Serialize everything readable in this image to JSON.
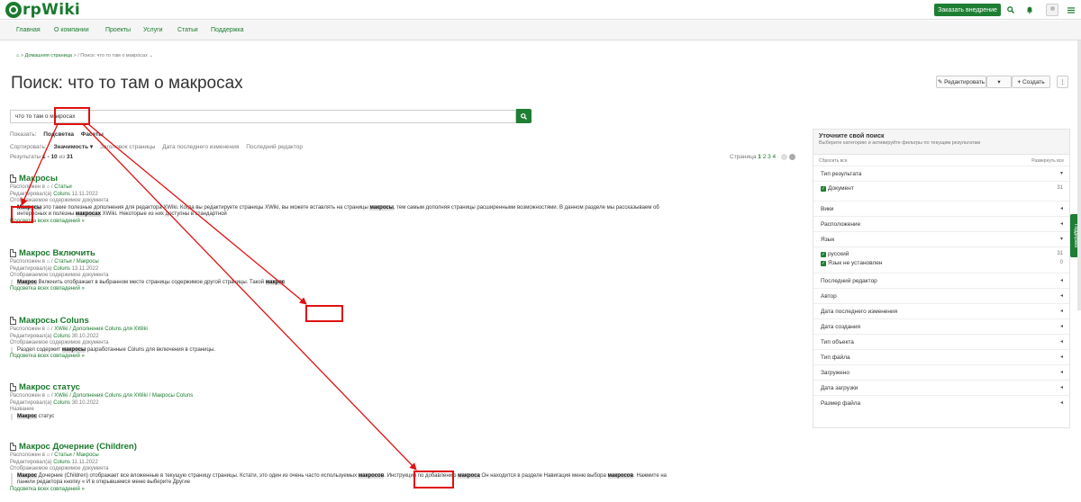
{
  "header": {
    "logo_text": "rpWiki",
    "order_button": "Заказать внедрение",
    "search_icon": "search-icon",
    "bell_icon": "bell-icon",
    "menu_icon": "hamburger-icon"
  },
  "menu": [
    "Главная",
    "О компании",
    "Проекты",
    "Услуги",
    "Статьи",
    "Поддержка"
  ],
  "breadcrumb": {
    "home": "Домашняя страница",
    "current": "Поиск: что то там о макросах"
  },
  "page_title": "Поиск: что то там о макросах",
  "actions": {
    "edit": "Редактировать",
    "create": "Создать"
  },
  "search": {
    "value": "что то там о макросах"
  },
  "show": {
    "label": "Показать:",
    "highlight": "Подсветка",
    "facets": "Фасеты"
  },
  "sort": {
    "label": "Сортировать:",
    "active": "Значимость",
    "options": [
      "Заголовок страницы",
      "Дата последнего изменения",
      "Последний редактор"
    ]
  },
  "results_summary": {
    "prefix": "Результаты",
    "range": "1 - 10",
    "of": "из",
    "total": "31"
  },
  "pagination": {
    "label": "Страница",
    "current": "1",
    "pages": "2 3 4"
  },
  "results": [
    {
      "title": "Макросы",
      "location": "Статьи",
      "edited_label": "Редактировал(а)",
      "editor": "Coluns",
      "date": "11.11.2022",
      "content_label": "Отображаемое содержимое документа",
      "more": "Подсветка всех совпадений »"
    },
    {
      "title": "Макрос Включить",
      "location": "Статьи / Макросы",
      "edited_label": "Редактировал(а)",
      "editor": "Coluns",
      "date": "13.11.2022",
      "content_label": "Отображаемое содержимое документа",
      "more": "Подсветка всех совпадений »"
    },
    {
      "title": "Макросы Coluns",
      "location": "XWiki / Дополнения Coluns для XWiki",
      "edited_label": "Редактировал(а)",
      "editor": "Coluns",
      "date": "30.10.2022",
      "content_label": "Отображаемое содержимое документа",
      "more": "Подсветка всех совпадений »"
    },
    {
      "title": "Макрос статус",
      "location": "XWiki / Дополнения Coluns для XWiki / Макросы Coluns",
      "edited_label": "Редактировал(а)",
      "editor": "Coluns",
      "date": "30.10.2022",
      "content_label": "Название"
    },
    {
      "title": "Макрос Дочерние (Children)",
      "location": "Статьи / Макросы",
      "edited_label": "Редактировал(а)",
      "editor": "Coluns",
      "date": "11.11.2022",
      "content_label": "Отображаемое содержимое документа",
      "more": "Подсветка всех совпадений »"
    }
  ],
  "excerpts": {
    "r1_a": "Макросы",
    "r1_b": " это такие полезные дополнения для редактора XWiki. Когда вы редактируете страницы XWiki, вы можете вставлять на страницы ",
    "r1_c": "макросы",
    "r1_d": ", тем самым дополняя страницы расширенными возможностями. В данном разделе мы рассказываем об",
    "r1_e": "интересных и полезны ",
    "r1_f": "макросах",
    "r1_g": " XWiki. Некоторые из них доступны в стандартной",
    "r2_a": "Макрос",
    "r2_b": " Включить отображает в выбранном месте страницы содержимое другой страницы. Такой ",
    "r2_c": "макрос",
    "r3_a": "Раздел содержит ",
    "r3_b": "макросы",
    "r3_c": " разработанные Coluns для включения в страницы.",
    "r4_a": "Макрос",
    "r4_b": " статус",
    "r5_a": "Макрос",
    "r5_b": " Дочерние (Children) отображает все вложенные в текущую страницу страницы. Кстати, это один из очень часто используемых ",
    "r5_c": "макросов",
    "r5_d": ". Инструкция по добавлению ",
    "r5_e": "макроса",
    "r5_f": " Он находится в разделе Навигация меню выбора ",
    "r5_g": "макросов",
    "r5_h": ". Нажмите на",
    "r5_i": "панели редактора кнопку « И в открывшемся меню выберите Другие",
    "located_in": "Расположен в"
  },
  "refine": {
    "title": "Уточните свой поиск",
    "subtitle": "Выберите категорию и активируйте фильтры по текущим результатам",
    "reset": "Сбросить все",
    "expand": "Развернуть все",
    "facets": [
      {
        "name": "Тип результата",
        "values": [
          {
            "label": "Документ",
            "count": "31"
          }
        ]
      },
      {
        "name": "Вики"
      },
      {
        "name": "Расположение"
      },
      {
        "name": "Язык",
        "values": [
          {
            "label": "русский",
            "count": "31"
          },
          {
            "label": "Язык не установлен",
            "count": "0"
          }
        ]
      },
      {
        "name": "Последний редактор"
      },
      {
        "name": "Автор"
      },
      {
        "name": "Дата последнего изменения"
      },
      {
        "name": "Дата создания"
      },
      {
        "name": "Тип объекта"
      },
      {
        "name": "Тип файла"
      },
      {
        "name": "Загружено"
      },
      {
        "name": "Дата загрузки"
      },
      {
        "name": "Размер файла"
      }
    ]
  },
  "side_tab": "Поддержка",
  "colors": {
    "brand_green": "#1e7e34",
    "link_green": "#1a7a2e",
    "annotation_red": "#e01010"
  }
}
